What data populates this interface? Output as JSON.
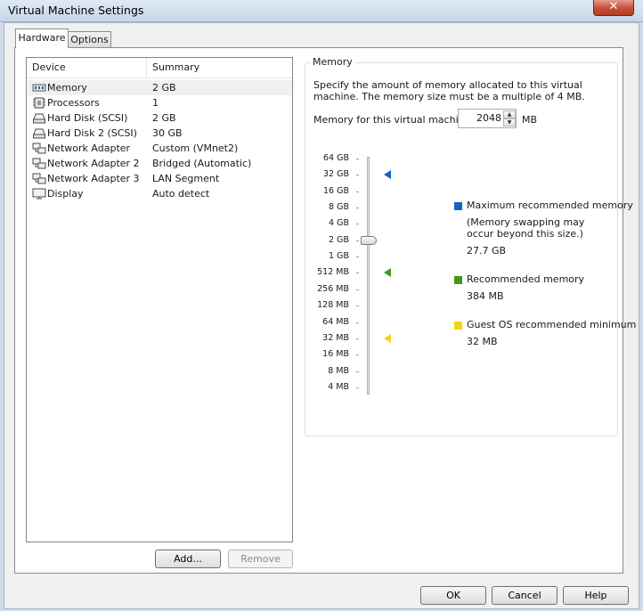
{
  "window": {
    "title": "Virtual Machine Settings",
    "close_glyph": "✕"
  },
  "tabs": [
    {
      "label": "Hardware",
      "active": true
    },
    {
      "label": "Options",
      "active": false
    }
  ],
  "device_list": {
    "columns": [
      "Device",
      "Summary"
    ],
    "rows": [
      {
        "device": "Memory",
        "summary": "2 GB",
        "icon": "memory-icon",
        "selected": true
      },
      {
        "device": "Processors",
        "summary": "1",
        "icon": "processor-icon"
      },
      {
        "device": "Hard Disk (SCSI)",
        "summary": "2 GB",
        "icon": "hard-disk-icon"
      },
      {
        "device": "Hard Disk 2 (SCSI)",
        "summary": "30 GB",
        "icon": "hard-disk-icon"
      },
      {
        "device": "Network Adapter",
        "summary": "Custom (VMnet2)",
        "icon": "network-adapter-icon"
      },
      {
        "device": "Network Adapter 2",
        "summary": "Bridged (Automatic)",
        "icon": "network-adapter-icon"
      },
      {
        "device": "Network Adapter 3",
        "summary": "LAN Segment",
        "icon": "network-adapter-icon"
      },
      {
        "device": "Display",
        "summary": "Auto detect",
        "icon": "display-icon"
      }
    ],
    "add_label": "Add...",
    "remove_label": "Remove"
  },
  "memory": {
    "group_title": "Memory",
    "description": "Specify the amount of memory allocated to this virtual machine. The memory size must be a multiple of 4 MB.",
    "field_label": "Memory for this virtual machine:",
    "value": "2048",
    "unit": "MB",
    "scale_labels": [
      "64 GB",
      "32 GB",
      "16 GB",
      "8 GB",
      "4 GB",
      "2 GB",
      "1 GB",
      "512 MB",
      "256 MB",
      "128 MB",
      "64 MB",
      "32 MB",
      "16 MB",
      "8 MB",
      "4 MB"
    ],
    "slider_level": "2 GB",
    "legend": {
      "max": {
        "label": "Maximum recommended memory",
        "note_line1": "(Memory swapping may",
        "note_line2": "occur beyond this size.)",
        "value": "27.7 GB",
        "color": "#1565c0",
        "scale_level": "32 GB"
      },
      "recommended": {
        "label": "Recommended memory",
        "value": "384 MB",
        "color": "#3f9a1c",
        "scale_level": "512 MB"
      },
      "guest_min": {
        "label": "Guest OS recommended minimum",
        "value": "32 MB",
        "color": "#f2d40f",
        "scale_level": "32 MB"
      }
    }
  },
  "footer": {
    "ok_label": "OK",
    "cancel_label": "Cancel",
    "help_label": "Help"
  }
}
